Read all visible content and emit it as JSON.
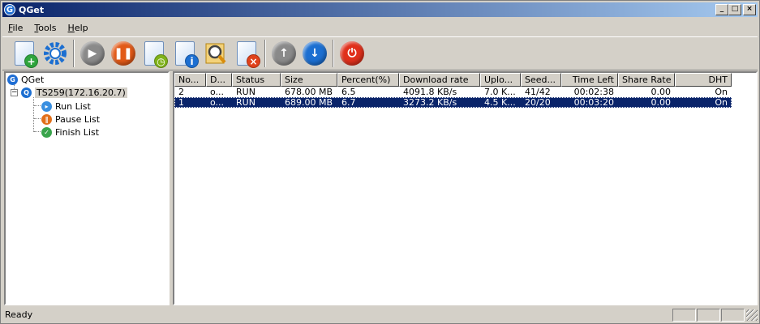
{
  "window": {
    "title": "QGet"
  },
  "menu": {
    "items": [
      {
        "label": "File",
        "accel": "F",
        "rest": "ile"
      },
      {
        "label": "Tools",
        "accel": "T",
        "rest": "ools"
      },
      {
        "label": "Help",
        "accel": "H",
        "rest": "elp"
      }
    ]
  },
  "toolbar": {
    "buttons": [
      {
        "name": "add-task-icon",
        "color": "#2ea43c"
      },
      {
        "name": "settings-icon",
        "color": "#1c6fd1"
      },
      {
        "name": "start-icon",
        "color": "#8a8a8a"
      },
      {
        "name": "pause-icon",
        "color": "#e25a18"
      },
      {
        "name": "schedule-icon",
        "color": "#7fb21a"
      },
      {
        "name": "info-icon",
        "color": "#1c6fd1"
      },
      {
        "name": "search-icon",
        "color": "#d98c0c"
      },
      {
        "name": "delete-icon",
        "color": "#e0421b"
      },
      {
        "name": "move-up-icon",
        "color": "#8a8a8a"
      },
      {
        "name": "move-down-icon",
        "color": "#1c6fd1"
      },
      {
        "name": "power-icon",
        "color": "#e0301b"
      }
    ]
  },
  "tree": {
    "root": "QGet",
    "server": "TS259(172.16.20.7)",
    "children": [
      "Run List",
      "Pause List",
      "Finish List"
    ]
  },
  "list": {
    "columns": [
      "No...",
      "D...",
      "Status",
      "Size",
      "Percent(%)",
      "Download rate",
      "Uplo...",
      "Seed...",
      "Time Left",
      "Share Rate",
      "DHT"
    ],
    "rows": [
      [
        "2",
        "o...",
        "RUN",
        "678.00 MB",
        "6.5",
        "4091.8 KB/s",
        "7.0 K...",
        "41/42",
        "00:02:38",
        "0.00",
        "On"
      ],
      [
        "1",
        "o...",
        "RUN",
        "689.00 MB",
        "6.7",
        "3273.2 KB/s",
        "4.5 K...",
        "20/20",
        "00:03:20",
        "0.00",
        "On"
      ]
    ]
  },
  "status": {
    "text": "Ready"
  },
  "colors": {
    "selection": "#0a246a",
    "face": "#d4d0c8"
  }
}
